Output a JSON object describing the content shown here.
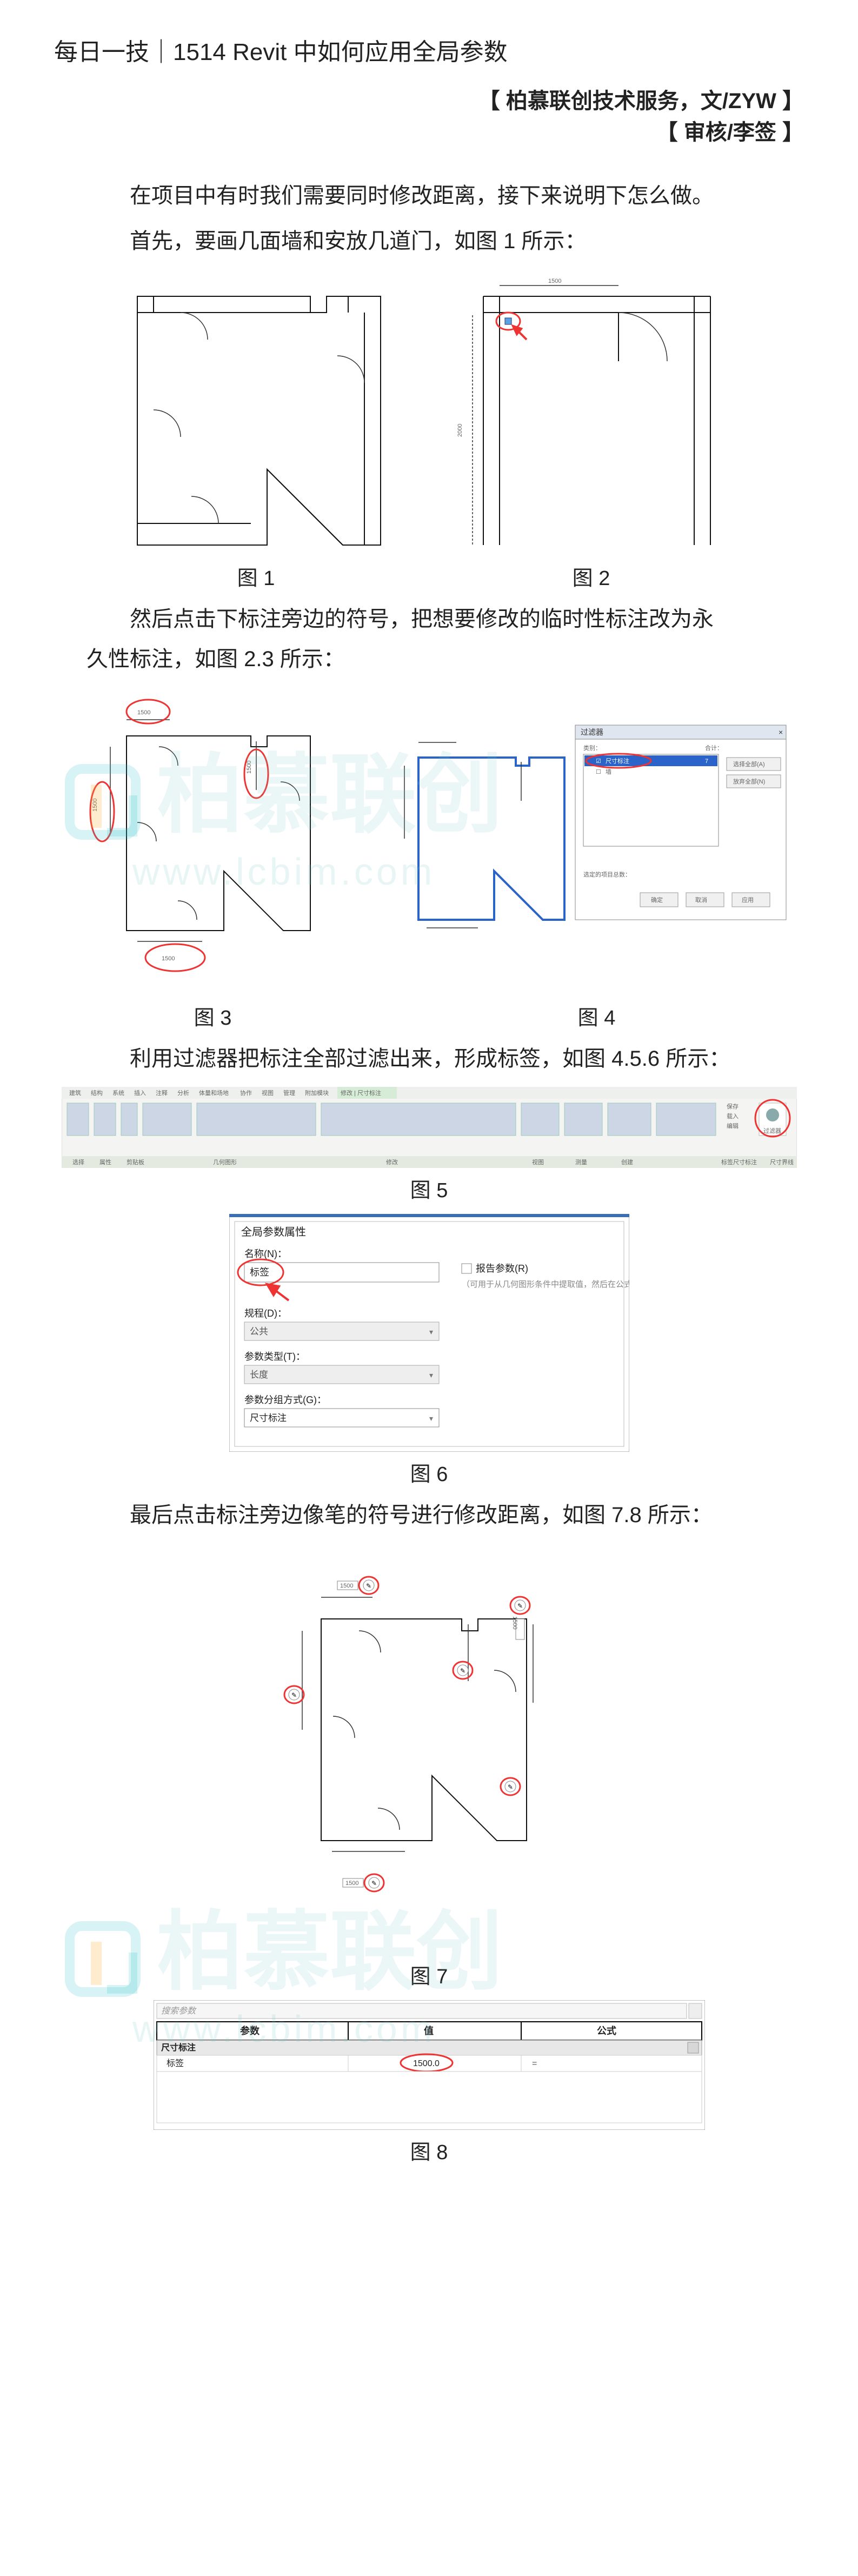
{
  "title": "每日一技｜1514 Revit 中如何应用全局参数",
  "byline1": "【 柏慕联创技术服务，文/ZYW 】",
  "byline2": "【 审核/李签 】",
  "p1": "在项目中有时我们需要同时修改距离，接下来说明下怎么做。",
  "p2": "首先，要画几面墙和安放几道门，如图 1 所示：",
  "fig1": "图 1",
  "fig2": "图 2",
  "p3a": "然后点击下标注旁边的符号，把想要修改的临时性标注改为永",
  "p3b": "久性标注，如图 2.3 所示：",
  "fig3": "图 3",
  "fig4": "图 4",
  "p4": "利用过滤器把标注全部过滤出来，形成标签，如图 4.5.6 所示：",
  "fig5": "图 5",
  "fig6": "图 6",
  "p5": "最后点击标注旁边像笔的符号进行修改距离，如图 7.8 所示：",
  "fig7": "图 7",
  "fig8": "图 8",
  "watermark_main": "柏慕联创",
  "watermark_sub": "www.lcbim.com",
  "fig2_dim": "1500",
  "filter_dialog": {
    "title": "过滤器",
    "category_label": "类别：",
    "count_label": "合计：",
    "item1": "尺寸标注",
    "item1_count": "7",
    "item2": "墙",
    "btn_all": "选择全部(A)",
    "btn_none": "放弃全部(N)",
    "total_label": "选定的项目总数：",
    "ok": "确定",
    "cancel": "取消",
    "apply": "应用"
  },
  "ribbon": {
    "tabs": [
      "建筑",
      "结构",
      "系统",
      "插入",
      "注释",
      "分析",
      "体量和场地",
      "协作",
      "视图",
      "管理",
      "附加模块",
      "修改 | 尺寸标注"
    ],
    "groups": [
      "选择",
      "属性",
      "剪贴板",
      "几何图形",
      "修改",
      "视图",
      "测量",
      "创建",
      "标签尺寸标注",
      "尺寸界线"
    ],
    "right_label": "编辑",
    "filter_btn": "过滤器",
    "save_btn": " 保存",
    "load_btn": " 载入"
  },
  "global_param": {
    "title": "全局参数属性",
    "name_label": "名称(N)：",
    "name_value": "标签",
    "report_checkbox": "报告参数(R)",
    "report_desc": "（可用于从几何图形条件中提取值，然后在公式中报告）",
    "discipline_label": "规程(D)：",
    "discipline_value": "公共",
    "type_label": "参数类型(T)：",
    "type_value": "长度",
    "group_label": "参数分组方式(G)：",
    "group_value": "尺寸标注"
  },
  "fig7_dim_top": "1500",
  "fig7_dim_side": "1500",
  "table8": {
    "search": "搜索参数",
    "h1": "参数",
    "h2": "值",
    "h3": "公式",
    "section": "尺寸标注",
    "row_label": "标签",
    "row_value": "1500.0"
  }
}
